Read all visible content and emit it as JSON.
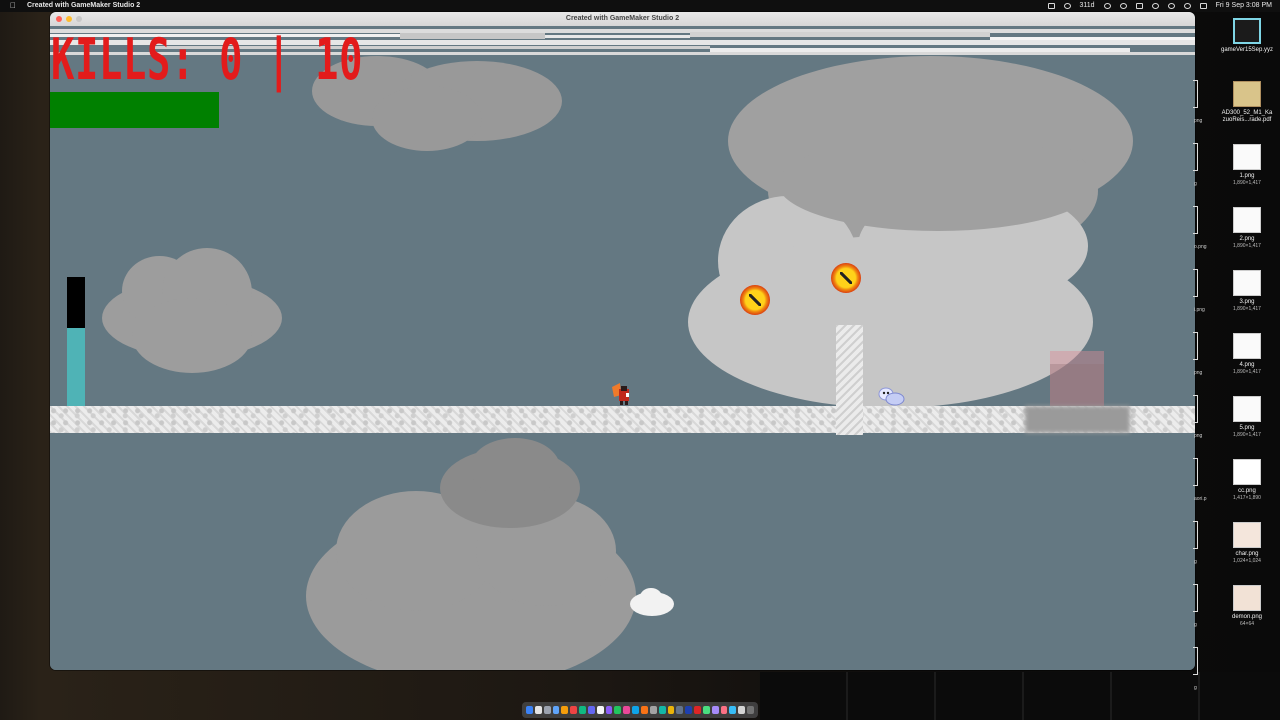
{
  "menubar": {
    "app_name": "Created with GameMaker Studio 2",
    "battery_label": "311d",
    "clock": "Fri 9 Sep  3:08 PM"
  },
  "window": {
    "title": "Created with GameMaker Studio 2",
    "lights": {
      "close": "#ff5f57",
      "minimize": "#febc2e",
      "zoom": "#c8c8c8"
    }
  },
  "hud": {
    "kills_label": "KILLS: 0 | 10",
    "kills": 0,
    "kills_target": 10,
    "meter_level": 0.62,
    "colors": {
      "kills_text": "#e31b1b",
      "health": "#008000",
      "meter": "#4fb3b6"
    }
  },
  "scene": {
    "sky_color": "#647882",
    "enemies": [
      "fire-demon-icon",
      "fire-demon-icon"
    ],
    "player": "player-sprite",
    "creature": "blue-blob-creature"
  },
  "dock": {
    "item_count": 26
  },
  "desktop": {
    "icons": [
      {
        "name": "gameVer15Sep.yyz",
        "sub": ""
      },
      {
        "name": "AD300_52_M1_Ka zuoReis...rade.pdf",
        "sub": ""
      },
      {
        "name": "1.png",
        "sub": "1,890×1,417"
      },
      {
        "name": "2.png",
        "sub": "1,890×1,417"
      },
      {
        "name": "3.png",
        "sub": "1,890×1,417"
      },
      {
        "name": "4.png",
        "sub": "1,890×1,417"
      },
      {
        "name": "5.png",
        "sub": "1,890×1,417"
      },
      {
        "name": "cc.png",
        "sub": "1,417×1,890"
      },
      {
        "name": "char.png",
        "sub": "1,024×1,024"
      },
      {
        "name": "demon.png",
        "sub": "64×64"
      }
    ],
    "peek_labels": [
      "png",
      "g",
      "o.png",
      "i.png",
      "png",
      "png",
      "aori.p",
      "g",
      "g",
      "g"
    ]
  }
}
